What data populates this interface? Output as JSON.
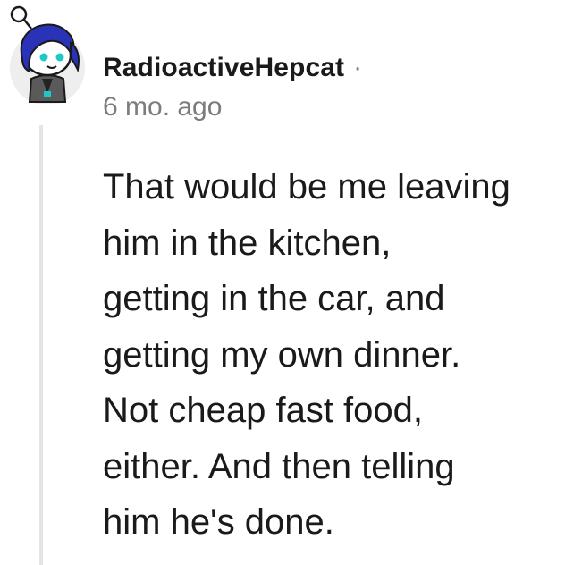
{
  "comment": {
    "author": {
      "username": "RadioactiveHepcat",
      "separator": "·",
      "avatar_icon": "snoo-avatar-blue-hair-icon"
    },
    "timestamp": "6 mo. ago",
    "body_lines": [
      "That would be me leaving",
      "him in the kitchen,",
      "getting in the car, and",
      "getting my own dinner.",
      "Not cheap fast food,",
      "either. And then telling",
      "him he's done."
    ]
  },
  "colors": {
    "text": "#1a1a1b",
    "meta": "#7c7c7c",
    "thread_line": "#e5e5e5",
    "avatar_hair": "#2a33b8",
    "avatar_eyes": "#1ec8c8"
  }
}
